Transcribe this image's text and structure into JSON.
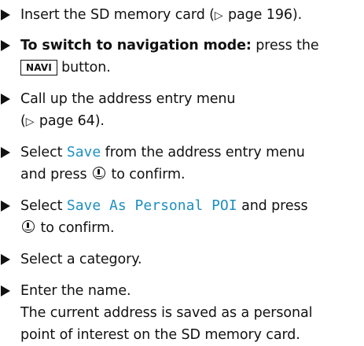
{
  "steps": [
    {
      "pre": "Insert the SD memory card (",
      "ref_arrow": "▷",
      "ref": " page 196)."
    },
    {
      "bold": "To switch to navigation mode:",
      "text1": " press the",
      "key": "NAVI",
      "text2": "button."
    },
    {
      "line1": "Call up the address entry menu",
      "ref_open": "(",
      "ref_arrow": "▷",
      "ref": " page 64)."
    },
    {
      "pre": "Select ",
      "display": "Save",
      "mid": " from the address entry menu",
      "line2a": "and press ",
      "knob_icon": "confirm-knob-icon",
      "line2b": " to confirm."
    },
    {
      "pre": "Select ",
      "display": "Save As Personal POI",
      "mid": " and press",
      "knob_icon": "confirm-knob-icon",
      "line2b": " to confirm."
    },
    {
      "text": "Select a category."
    },
    {
      "text": "Enter the name.",
      "result1": "The current address is saved as a personal",
      "result2": "point of interest on the SD memory card."
    }
  ],
  "colors": {
    "text": "#111111",
    "display_text": "#1f8fbf"
  }
}
